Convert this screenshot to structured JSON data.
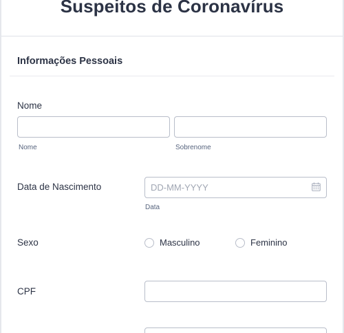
{
  "form": {
    "title": "Suspeitos de Coronavírus",
    "section_title": "Informações Pessoais"
  },
  "name_field": {
    "label": "Nome",
    "first": {
      "value": "",
      "placeholder": "",
      "sublabel": "Nome"
    },
    "last": {
      "value": "",
      "placeholder": "",
      "sublabel": "Sobrenome"
    }
  },
  "birth_date": {
    "label": "Data de Nascimento",
    "value": "",
    "placeholder": "DD-MM-YYYY",
    "sublabel": "Data",
    "icon": "calendar-icon"
  },
  "sex": {
    "label": "Sexo",
    "options": [
      {
        "label": "Masculino",
        "selected": false
      },
      {
        "label": "Feminino",
        "selected": false
      }
    ]
  },
  "cpf": {
    "label": "CPF",
    "value": "",
    "placeholder": ""
  },
  "colors": {
    "text": "#2c3345",
    "sublabel": "#57647e",
    "border": "#b8bdc9",
    "placeholder": "#a0a6b3"
  }
}
